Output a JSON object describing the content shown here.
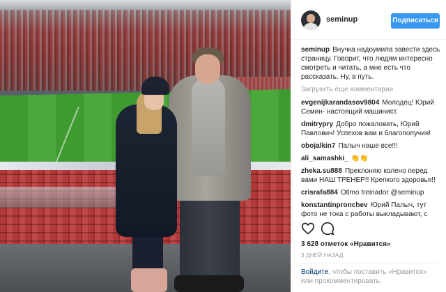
{
  "header": {
    "username": "seminup",
    "follow_label": "Подписаться"
  },
  "caption": {
    "username": "seminup",
    "text": "Внучка надоумила завести здесь страницу. Говорит, что людям интересно смотреть и читать, а мне есть что рассказать. Ну, в путь."
  },
  "load_more_label": "Загрузить еще комментарии",
  "comments": [
    {
      "user": "evgenijkarandasov9804",
      "text": "Молодец! Юрий Семин- настоящий машинист."
    },
    {
      "user": "dmitrypry",
      "text": "Добро пожаловать, Юрий Павлович! Успехов вам и благополучия!"
    },
    {
      "user": "obojalkin7",
      "text": "Палыч наше все!!!"
    },
    {
      "user": "ali_samashki_",
      "text": "👏👏"
    },
    {
      "user": "zheka.su888",
      "text": "Преклоняю колено перед вами НАШ ТРЕНЕР!! Крепкого здоровья!!"
    },
    {
      "user": "crisrafa884",
      "text": "Otimo treinador @seminup"
    },
    {
      "user": "konstantinpronchev",
      "text": "Юрий Палыч, тут фото не тока с работы выкладывают, с"
    }
  ],
  "likes_text": "3 628 отметок «Нравится»",
  "date_text": "3 ДНЕЙ НАЗАД",
  "login_hint": {
    "link1": "Войдите",
    "text1": ", чтобы поставить «Нравится»",
    "text2": "или прокомментировать."
  },
  "icons": {
    "like": "heart-icon",
    "comment": "comment-icon"
  },
  "colors": {
    "follow_button": "#3897f0",
    "muted_text": "#999999",
    "link_text": "#003569"
  }
}
